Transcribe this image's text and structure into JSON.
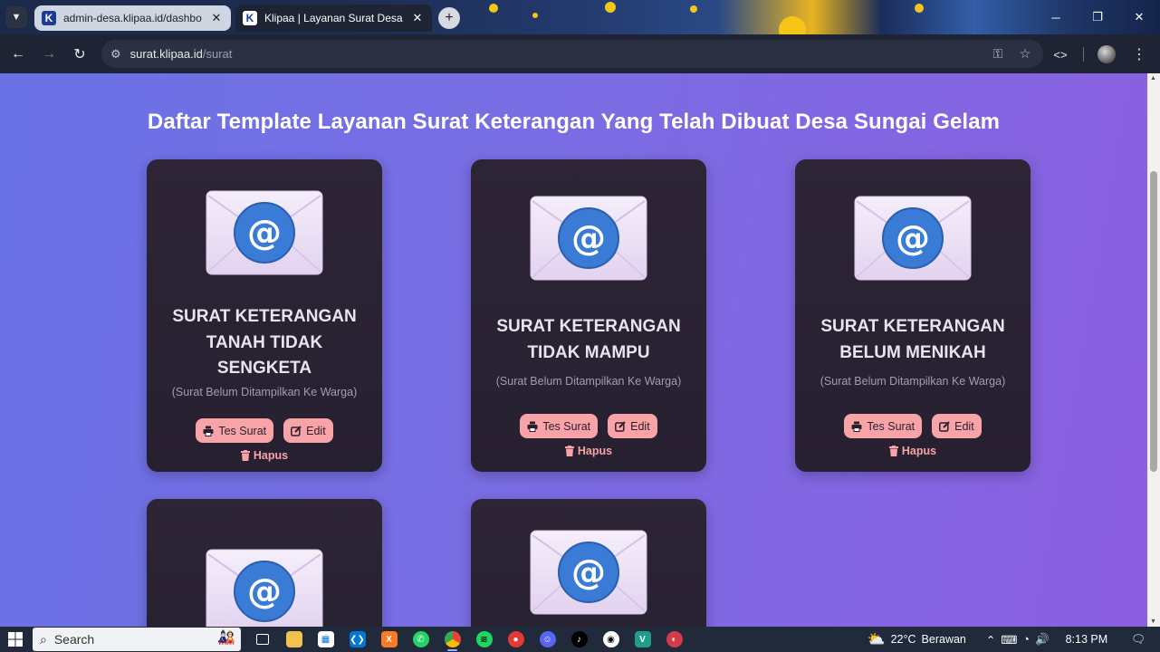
{
  "browser": {
    "tabs": [
      {
        "title": "admin-desa.klipaa.id/dashboard",
        "favicon": "K",
        "active": false
      },
      {
        "title": "Klipaa | Layanan Surat Desa sungai gelam",
        "favicon": "K",
        "active": true
      }
    ],
    "address": {
      "host": "surat.klipaa.id",
      "path": "/surat"
    }
  },
  "page": {
    "title": "Daftar Template Layanan Surat Keterangan Yang Telah Dibuat Desa Sungai Gelam",
    "cards": [
      {
        "title_lines": [
          "SURAT KETERANGAN",
          "TANAH TIDAK",
          "SENGKETA"
        ],
        "status": "(Surat Belum Ditampilkan Ke Warga)",
        "test_label": "Tes Surat",
        "edit_label": "Edit",
        "delete_label": "Hapus"
      },
      {
        "title_lines": [
          "SURAT KETERANGAN",
          "TIDAK MAMPU"
        ],
        "status": "(Surat Belum Ditampilkan Ke Warga)",
        "test_label": "Tes Surat",
        "edit_label": "Edit",
        "delete_label": "Hapus"
      },
      {
        "title_lines": [
          "SURAT KETERANGAN",
          "BELUM MENIKAH"
        ],
        "status": "(Surat Belum Ditampilkan Ke Warga)",
        "test_label": "Tes Surat",
        "edit_label": "Edit",
        "delete_label": "Hapus"
      }
    ]
  },
  "taskbar": {
    "search_placeholder": "Search",
    "weather": {
      "temp": "22°C",
      "condition": "Berawan"
    },
    "time": "8:13 PM"
  },
  "icons": {
    "envelope": "email-envelope-icon",
    "print": "print-icon",
    "edit": "edit-icon",
    "trash": "trash-icon"
  },
  "colors": {
    "page_gradient_start": "#6a72e6",
    "page_gradient_end": "#8b5fe0",
    "card_bg": "#2d2535",
    "button_pink": "#f7a3a7",
    "envelope_badge": "#3a7bd5"
  }
}
